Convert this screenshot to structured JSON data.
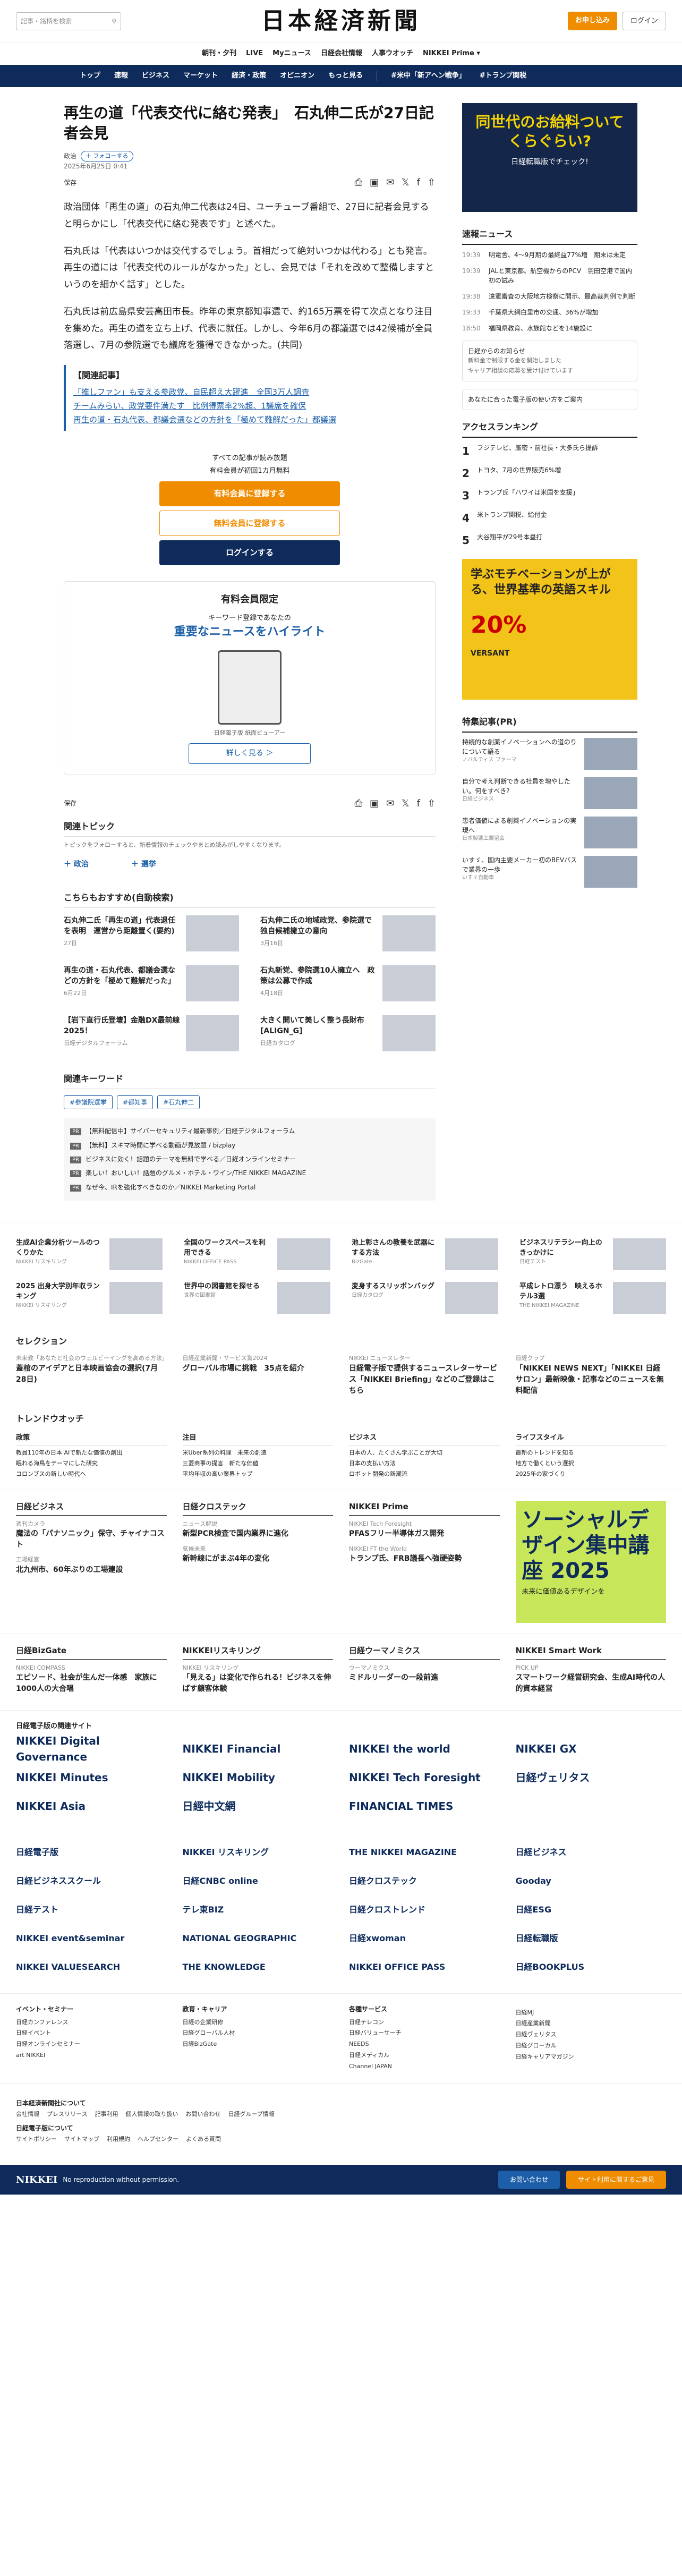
{
  "header": {
    "search_placeholder": "記事・銘柄を検索",
    "logo": "日本経済新聞",
    "subscribe": "お申し込み",
    "login": "ログイン"
  },
  "subnav": [
    "朝刊・夕刊",
    "LIVE",
    "Myニュース",
    "日経会社情報",
    "人事ウオッチ",
    "NIKKEI Prime ▾"
  ],
  "mainnav": [
    "トップ",
    "速報",
    "ビジネス",
    "マーケット",
    "経済・政策",
    "オピニオン",
    "もっと見る",
    "#米中「新アヘン戦争」",
    "#トランプ関税"
  ],
  "article": {
    "title": "再生の道「代表交代に絡む発表」　石丸伸二氏が27日記者会見",
    "section": "政治",
    "follow": "＋ フォローする",
    "date": "2025年6月25日 0:41",
    "save": "保存",
    "paras": [
      "政治団体「再生の道」の石丸伸二代表は24日、ユーチューブ番組で、27日に記者会見すると明らかにし「代表交代に絡む発表です」と述べた。",
      "石丸氏は「代表はいつかは交代するでしょう。首相だって絶対いつかは代わる」とも発言。再生の道には「代表交代のルールがなかった」とし、会見では「それを改めて整備しますというのを細かく話す」とした。",
      "石丸氏は前広島県安芸高田市長。昨年の東京都知事選で、約165万票を得て次点となり注目を集めた。再生の道を立ち上げ、代表に就任。しかし、今年6月の都議選では42候補が全員落選し、7月の参院選でも議席を獲得できなかった。(共同)"
    ],
    "related_title": "【関連記事】",
    "related": [
      "「推しファン」も支える参政党、自民超え大躍進　全国3万人調査",
      "チームみらい、政党要件満たす　比例得票率2%超、1議席を確保",
      "再生の道・石丸代表、都議会選などの方針を「極めて難解だった」都議選"
    ]
  },
  "paywall": {
    "l1": "すべての記事が読み放題",
    "l2": "有料会員が初回1カ月無料",
    "b1": "有料会員に登録する",
    "b2": "無料会員に登録する",
    "b3": "ログインする"
  },
  "member_box": {
    "title": "有料会員限定",
    "sub": "キーワード登録であなたの",
    "hl": "重要なニュースをハイライト",
    "cap": "日経電子版 紙面ビューアー",
    "more": "詳しく見る ＞"
  },
  "topics": {
    "title": "関連トピック",
    "sub": "トピックをフォローすると、新着情報のチェックやまとめ読みがしやすくなります。",
    "items": [
      "＋ 政治",
      "＋ 選挙"
    ]
  },
  "recommend": {
    "title": "こちらもおすすめ(自動検索)",
    "items": [
      {
        "t": "石丸伸二氏「再生の道」代表退任を表明　運営から距離置く(要約)",
        "d": "27日"
      },
      {
        "t": "石丸伸二氏の地域政党、参院選で独自候補擁立の意向",
        "d": "3月16日"
      },
      {
        "t": "再生の道・石丸代表、都議会選などの方針を「極めて難解だった」",
        "d": "6月22日"
      },
      {
        "t": "石丸新党、参院選10人擁立へ　政策は公募で作成",
        "d": "4月18日"
      },
      {
        "t": "【岩下直行氏登壇】金融DX最前線2025！",
        "d": "日経デジタルフォーラム"
      },
      {
        "t": "大きく開いて美しく整う長財布 [ALIGN_G]",
        "d": "日経カタログ"
      }
    ]
  },
  "keywords": {
    "title": "関連キーワード",
    "items": [
      "#参議院選挙",
      "#都知事",
      "#石丸伸二"
    ]
  },
  "pr": [
    "【無料配信中】サイバーセキュリティ最新事例／日経デジタルフォーラム",
    "【無料】スキマ時間に学べる動画が見放題 / bizplay",
    "ビジネスに効く！話題のテーマを無料で学べる／日経オンラインセミナー",
    "楽しい！おいしい！話題のグルメ・ホテル・ワイン/THE NIKKEI MAGAZINE",
    "なぜ今、IRを強化すべきなのか／NIKKEI Marketing Portal"
  ],
  "side": {
    "ad_title": "同世代のお給料ついてくらぐらい?",
    "ad_sub": "日経転職版でチェック!",
    "news_title": "速報ニュース",
    "news": [
      {
        "t": "19:39",
        "h": "明電舎、4～9月期の最終益77%増　期末は未定"
      },
      {
        "t": "19:39",
        "h": "JALと東京都、航空機からのPCV　羽田空港で国内初の試み"
      },
      {
        "t": "19:38",
        "h": "違憲審査の大阪地方検察に開示、最高裁判例で判断"
      },
      {
        "t": "19:33",
        "h": "千葉県大網白里市の交通、36%が増加"
      },
      {
        "t": "18:50",
        "h": "福岡県教育、水族館などを14施設に"
      }
    ],
    "box1_title": "日経からのお知らせ",
    "box1": [
      "新料金で制限する金を開始しました",
      "キャリア相談の応募を受け付けています"
    ],
    "box2_title": "あなたに合った電子版の使い方をご案内",
    "ranking_title": "アクセスランキング",
    "ranking": [
      "フジテレビ、厳密・前社長・大多氏ら提訴",
      "トヨタ、7月の世界販売6%増",
      "トランプ氏「ハワイは米国を支援」",
      "米トランプ関税、給付金",
      "大谷翔平が29号本塁打"
    ],
    "ad2_t": "学ぶモチベーションが上がる、世界基準の英語スキル",
    "ad2_v": "20%",
    "ad2_s": "VERSANT",
    "pr_title": "特集記事(PR)",
    "prs": [
      {
        "h": "持続的な創薬イノベーションへの道のりについて語る",
        "s": "ノバルティス ファーマ"
      },
      {
        "h": "自分で考え判断できる社員を増やしたい。何をすべき?",
        "s": "日経ビジネス"
      },
      {
        "h": "患者価値による創薬イノベーションの実現へ",
        "s": "日本製薬工業協会"
      },
      {
        "h": "いすゞ、国内主要メーカー初のBEVバスで業界の一歩",
        "s": "いすゞ自動車"
      }
    ]
  },
  "band": [
    {
      "h": "生成AI企業分析ツールのつくりかた",
      "s": "NIKKEI リスキリング"
    },
    {
      "h": "全国のワークスペースを利用できる",
      "s": "NIKKEI OFFICE PASS"
    },
    {
      "h": "池上彰さんの教養を武器にする方法",
      "s": "BizGate"
    },
    {
      "h": "ビジネスリテラシー向上のきっかけに",
      "s": "日経テスト"
    },
    {
      "h": "2025 出身大学別年収ランキング",
      "s": "NIKKEI リスキリング"
    },
    {
      "h": "世界中の図書館を探せる",
      "s": "世界の図書館"
    },
    {
      "h": "変身するスリッポンバッグ",
      "s": "日経カタログ"
    },
    {
      "h": "平成レトロ漂う　映えるホテル3選",
      "s": "THE NIKKEI MAGAZINE"
    }
  ],
  "selection": {
    "title": "セレクション",
    "items": [
      {
        "s": "未来教「あなたと社会のウェルビーイングを高める方法」",
        "h": "蓋棺のアイデアと日本映画協会の選択(7月28日)"
      },
      {
        "s": "日経産業新聞・サービス賞2024",
        "h": "グローバル市場に挑戦　35点を紹介"
      },
      {
        "s": "NIKKEI ニュースレター",
        "h": "日経電子版で提供するニュースレターサービス「NIKKEI Briefing」などのご登録はこちら"
      },
      {
        "s": "日経クラブ",
        "h": "「NIKKEI NEWS NEXT」「NIKKEI 日経サロン」最新映像・記事などのニュースを無料配信"
      }
    ]
  },
  "trend": {
    "title": "トレンドウオッチ",
    "cols": [
      {
        "h": "政策",
        "i": [
          "教員110年の日本 AIで新たな価値の創出",
          "眠れる海鳥をテーマにした研究",
          "コロンブスの新しい時代へ"
        ]
      },
      {
        "h": "注目",
        "i": [
          "米Uber系列の料理　未来の創造",
          "三菱商事の提言　新たな価値",
          "平均年収の高い業界トップ"
        ]
      },
      {
        "h": "ビジネス",
        "i": [
          "日本の人、たくさん学ぶことが大切",
          "日本の支払い方法",
          "ロボット開発の新潮流"
        ]
      },
      {
        "h": "ライフスタイル",
        "i": [
          "最新のトレンドを知る",
          "地方で働くという選択",
          "2025年の家づくり"
        ]
      }
    ]
  },
  "services": [
    {
      "h": "日経ビジネス",
      "a": [
        {
          "s": "週刊カメラ",
          "t": "魔法の「パナソニック」保守、チャイナコスト"
        },
        {
          "s": "工場経営",
          "t": "北九州市、60年ぶりの工場建設"
        }
      ]
    },
    {
      "h": "日経クロステック",
      "a": [
        {
          "s": "ニュース解説",
          "t": "新型PCR検査で国内業界に進化"
        },
        {
          "s": "気候未来",
          "t": "新幹線にがまぶ4年の変化"
        }
      ]
    },
    {
      "h": "NIKKEI Prime",
      "a": [
        {
          "s": "NIKKEI Tech Foresight",
          "t": "PFASフリー半導体ガス開発"
        },
        {
          "s": "NIKKEI FT the World",
          "t": "トランプ氏、FRB議長へ強硬姿勢"
        }
      ]
    },
    {
      "h": "",
      "ad": "ソーシャルデザイン集中講座 2025",
      "ad_sub": "未来に価値あるデザインを"
    }
  ],
  "services2": [
    {
      "h": "日経BizGate",
      "s": "NIKKEI COMPASS",
      "t": "エピソード、社会が生んだ一体感　家族に1000人の大合唱"
    },
    {
      "h": "NIKKEIリスキリング",
      "s": "NIKKEI リスキリング",
      "t": "「見える」は変化で作られる！ビジネスを伸ばす顧客体験"
    },
    {
      "h": "日経ウーマノミクス",
      "s": "ウーマノミクス",
      "t": "ミドルリーダーの一段前進"
    },
    {
      "h": "NIKKEI Smart Work",
      "s": "PICK UP",
      "t": "スマートワーク経営研究会、生成AI時代の人的資本経営"
    }
  ],
  "group_title": "日経電子版の関連サイト",
  "group": [
    "NIKKEI Digital Governance",
    "NIKKEI Financial",
    "NIKKEI the world",
    "NIKKEI GX",
    "NIKKEI Minutes",
    "NIKKEI Mobility",
    "NIKKEI Tech Foresight",
    "日経ヴェリタス",
    "NIKKEI Asia",
    "日經中文網",
    "FINANCIAL TIMES",
    ""
  ],
  "brands": [
    "日経電子版",
    "NIKKEI リスキリング",
    "THE NIKKEI MAGAZINE",
    "日経ビジネス",
    "日経ビジネススクール",
    "日経CNBC online",
    "日経クロステック",
    "Gooday",
    "日経テスト",
    "テレ東BIZ",
    "日経クロストレンド",
    "日経ESG",
    "NIKKEI event&seminar",
    "NATIONAL GEOGRAPHIC",
    "日経xwoman",
    "日経転職版",
    "NIKKEI VALUESEARCH",
    "THE KNOWLEDGE",
    "NIKKEI OFFICE PASS",
    "日経BOOKPLUS"
  ],
  "footer_lists": [
    {
      "h": "イベント・セミナー",
      "i": [
        "日経カンファレンス",
        "日経イベント",
        "日経オンラインセミナー",
        "art NIKKEI"
      ]
    },
    {
      "h": "教育・キャリア",
      "i": [
        "日経の企業研修",
        "日経グローバル人材",
        "日経BizGate"
      ]
    },
    {
      "h": "各種サービス",
      "i": [
        "日経テレコン",
        "日経バリューサーチ",
        "NEEDS",
        "日経メディカル",
        "Channel JAPAN"
      ]
    },
    {
      "h": "",
      "i": [
        "日経MJ",
        "日経産業新聞",
        "日経ヴェリタス",
        "日経グローカル",
        "日経キャリアマガジン"
      ]
    }
  ],
  "footer_links": {
    "h1": "日本経済新聞社について",
    "l1": [
      "会社情報",
      "プレスリリース",
      "記事利用",
      "個人情報の取り扱い",
      "お問い合わせ",
      "日経グループ情報"
    ],
    "h2": "日経電子版について",
    "l2": [
      "サイトポリシー",
      "サイトマップ",
      "利用規約",
      "ヘルプセンター",
      "よくある質問"
    ]
  },
  "footbar": {
    "logo": "NIKKEI",
    "copy": "No reproduction without permission.",
    "b1": "お問い合わせ",
    "b2": "サイト利用に関するご意見"
  }
}
